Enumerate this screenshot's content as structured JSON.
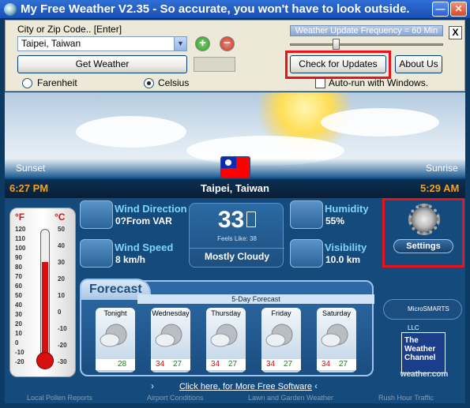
{
  "titlebar": {
    "title": "My Free Weather V2.35 -  So accurate, you won't have to look outside.",
    "minimize_label": "—",
    "close_label": "✕"
  },
  "controls": {
    "city_label": "City or Zip Code..  [Enter]",
    "city_value": "Taipei, Taiwan",
    "add_label": "+",
    "remove_label": "−",
    "get_weather_label": "Get Weather",
    "fahrenheit_label": "Farenheit",
    "celsius_label": "Celsius",
    "units_selected": "Celsius",
    "frequency_label": "Weather Update Frequency = 60 Min",
    "frequency_fraction": 0.3,
    "close_label": "X",
    "check_updates_label": "Check for Updates",
    "about_label": "About Us",
    "autorun_label": "Auto-run with Windows.",
    "autorun_checked": false
  },
  "weather": {
    "sunset_label": "Sunset",
    "sunrise_label": "Sunrise",
    "sunset_time": "6:27 PM",
    "sunrise_time": "5:29 AM",
    "location": "Taipei, Taiwan",
    "wind_direction_label": "Wind Direction",
    "wind_direction_value": "0?From VAR",
    "wind_speed_label": "Wind Speed",
    "wind_speed_value": "8 km/h",
    "temperature": "33",
    "feels_like": "Feels Like: 38",
    "condition": "Mostly Cloudy",
    "humidity_label": "Humidity",
    "humidity_value": "55%",
    "visibility_label": "Visibility",
    "visibility_value": "10.0 km",
    "settings_label": "Settings"
  },
  "thermometer": {
    "f_label": "°F",
    "c_label": "°C",
    "f_ticks": [
      "120",
      "110",
      "100",
      "90",
      "80",
      "70",
      "60",
      "50",
      "40",
      "30",
      "20",
      "10",
      "0",
      "-10",
      "-20"
    ],
    "c_ticks": [
      "50",
      "40",
      "30",
      "20",
      "10",
      "0",
      "-10",
      "-20",
      "-30"
    ]
  },
  "forecast": {
    "tab_label": "Forecast",
    "header": "5-Day Forecast",
    "days": [
      {
        "name": "Tonight",
        "hi": "",
        "lo": "28"
      },
      {
        "name": "Wednesday",
        "hi": "34",
        "lo": "27"
      },
      {
        "name": "Thursday",
        "hi": "34",
        "lo": "27"
      },
      {
        "name": "Friday",
        "hi": "34",
        "lo": "27"
      },
      {
        "name": "Saturday",
        "hi": "34",
        "lo": "27"
      }
    ]
  },
  "branding": {
    "microsmarts": "MicroSMARTS LLC",
    "twc_lines": [
      "The",
      "Weather",
      "Channel"
    ],
    "twc_url": "weather.com"
  },
  "links": {
    "more_software": "Click here, for More Free Software",
    "footer": [
      "Local Pollen Reports",
      "Airport Conditions",
      "Lawn and Garden Weather",
      "Rush Hour Traffic"
    ]
  },
  "colors": {
    "highlight": "#e8141c",
    "title_bar": "#2f6fd6",
    "time_accent": "#f5a020"
  }
}
